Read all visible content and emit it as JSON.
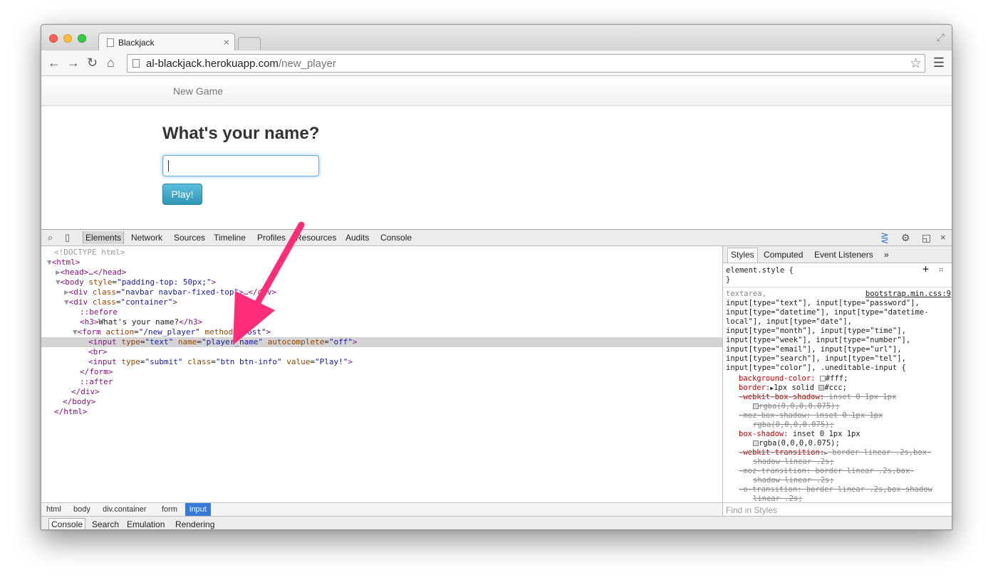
{
  "browser": {
    "tab_title": "Blackjack",
    "tab_close": "×",
    "url_host": "al-blackjack.herokuapp.com",
    "url_path": "/new_player",
    "icons": [
      "back-icon",
      "forward-icon",
      "reload-icon",
      "home-icon",
      "bookmark-star-icon",
      "menu-icon",
      "fullscreen-icon"
    ]
  },
  "page": {
    "nav_link": "New Game",
    "heading": "What's your name?",
    "input_value": "",
    "button_label": "Play!"
  },
  "devtools": {
    "tabs": [
      "Elements",
      "Network",
      "Sources",
      "Timeline",
      "Profiles",
      "Resources",
      "Audits",
      "Console"
    ],
    "active_tab": "Elements",
    "dom": {
      "doctype": "<!DOCTYPE html>",
      "html_open": "<html>",
      "head": "<head>…</head>",
      "body_tag": "body",
      "body_attr": "style",
      "body_val": "\"padding-top: 50px;\"",
      "navbar_tag": "div",
      "navbar_attr": "class",
      "navbar_val": "\"navbar navbar-fixed-top\"",
      "navbar_rest": ">…</div>",
      "container_tag": "div",
      "container_attr": "class",
      "container_val": "\"container\"",
      "before": "::before",
      "h3_open": "<h3>",
      "h3_text": "What's your name?",
      "h3_close": "</h3>",
      "form_tag": "form",
      "form_attr1": "action",
      "form_val1": "\"/new_player\"",
      "form_attr2": "method",
      "form_val2": "\"post\"",
      "input_tag": "input",
      "input_attr1": "type",
      "input_val1": "\"text\"",
      "input_attr2": "name",
      "input_val2": "\"player_name\"",
      "input_attr3": "autocomplete",
      "input_val3": "\"off\"",
      "br": "<br>",
      "submit_tag": "input",
      "submit_attr1": "type",
      "submit_val1": "\"submit\"",
      "submit_attr2": "class",
      "submit_val2": "\"btn btn-info\"",
      "submit_attr3": "value",
      "submit_val3": "\"Play!\"",
      "form_close": "</form>",
      "after": "::after",
      "div_close": "</div>",
      "body_close": "</body>",
      "html_close": "</html>"
    },
    "breadcrumbs": [
      "html",
      "body",
      "div.container",
      "form",
      "input"
    ],
    "styles_tabs": [
      "Styles",
      "Computed",
      "Event Listeners"
    ],
    "styles_more": "»",
    "element_style_open": "element.style {",
    "element_style_close": "}",
    "rule_source": "bootstrap.min.css:9",
    "selector_lines": [
      "textarea,",
      "input[type=\"text\"], input[type=\"password\"],",
      "input[type=\"datetime\"], input[type=\"datetime-",
      "local\"], input[type=\"date\"],",
      "input[type=\"month\"], input[type=\"time\"],",
      "input[type=\"week\"], input[type=\"number\"],",
      "input[type=\"email\"], input[type=\"url\"],",
      "input[type=\"search\"], input[type=\"tel\"],",
      "input[type=\"color\"], .uneditable-input {"
    ],
    "declarations": {
      "bg_prop": "background-color:",
      "bg_val": "#fff;",
      "border_prop": "border:",
      "border_val": "1px solid",
      "border_color": "#ccc;",
      "wk_shadow_prop": "-webkit-box-shadow:",
      "wk_shadow_val": "inset 0 1px 1px",
      "wk_shadow_val2": "rgba(0,0,0,0.075);",
      "moz_shadow_prop": "-moz-box-shadow:",
      "moz_shadow_val": "inset 0 1px 1px",
      "moz_shadow_val2": "rgba(0,0,0,0.075);",
      "shadow_prop": "box-shadow:",
      "shadow_val": "inset 0 1px 1px",
      "shadow_val2": "rgba(0,0,0,0.075);",
      "wk_trans_prop": "-webkit-transition:",
      "wk_trans_val": "border linear .2s,box-",
      "wk_trans_val2": "shadow linear .2s;",
      "moz_trans_prop": "-moz-transition:",
      "moz_trans_val": "border linear .2s,box-",
      "moz_trans_val2": "shadow linear .2s;",
      "o_trans_prop": "-o-transition:",
      "o_trans_val": "border linear .2s,box-shadow",
      "o_trans_val2": "linear .2s;"
    },
    "find_in_styles": "Find in Styles",
    "drawer_tabs": [
      "Console",
      "Search",
      "Emulation",
      "Rendering"
    ]
  },
  "colors": {
    "accent_pink": "#ff2d78",
    "selection_blue": "#3879d9",
    "play_button": "#49afcd"
  }
}
